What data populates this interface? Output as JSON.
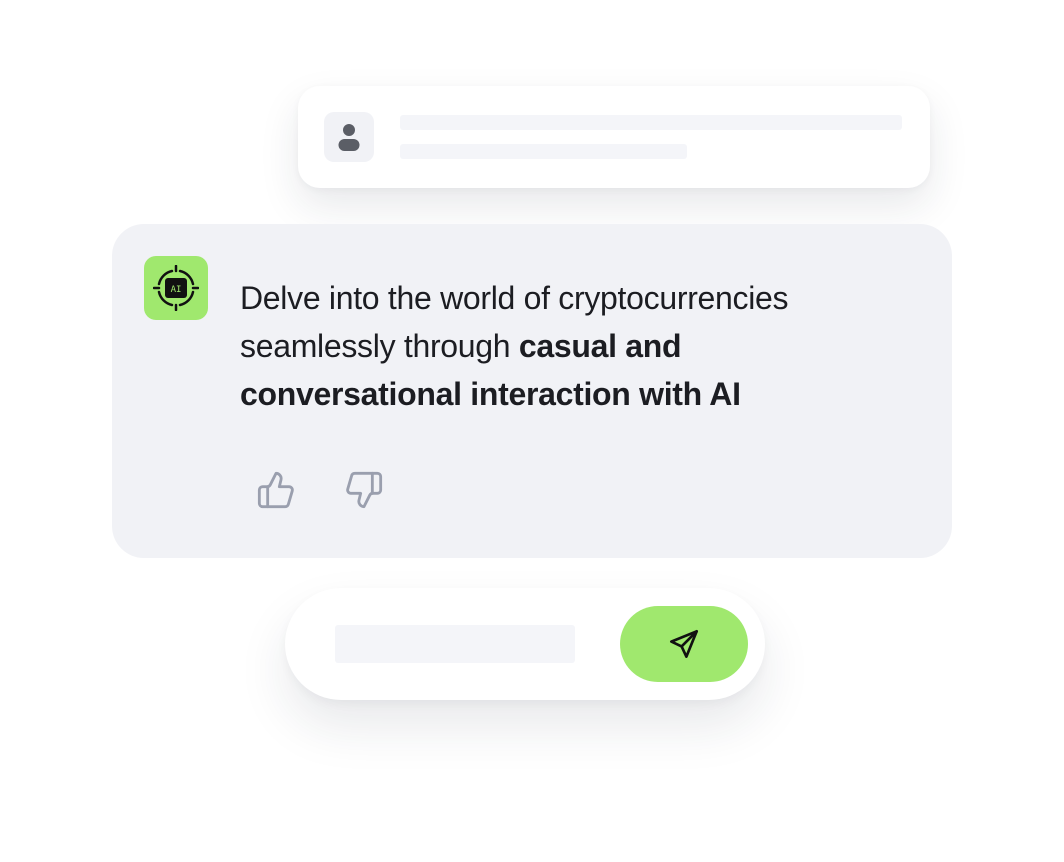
{
  "user_message": {
    "avatar_icon": "user-icon"
  },
  "ai_message": {
    "avatar_icon": "ai-chip-icon",
    "avatar_label": "AI",
    "text_regular": "Delve into the world of cryptocurrencies seamlessly through ",
    "text_bold": "casual and conversational interaction with AI",
    "feedback": {
      "like_icon": "thumbs-up-icon",
      "dislike_icon": "thumbs-down-icon"
    }
  },
  "composer": {
    "input_value": "",
    "send_icon": "send-icon"
  },
  "colors": {
    "accent": "#a0e86e",
    "card_background": "#f1f2f6",
    "skeleton": "#f4f5f9",
    "text": "#1c1d22",
    "icon_muted": "#9a9fae",
    "user_icon": "#5b5e66"
  }
}
